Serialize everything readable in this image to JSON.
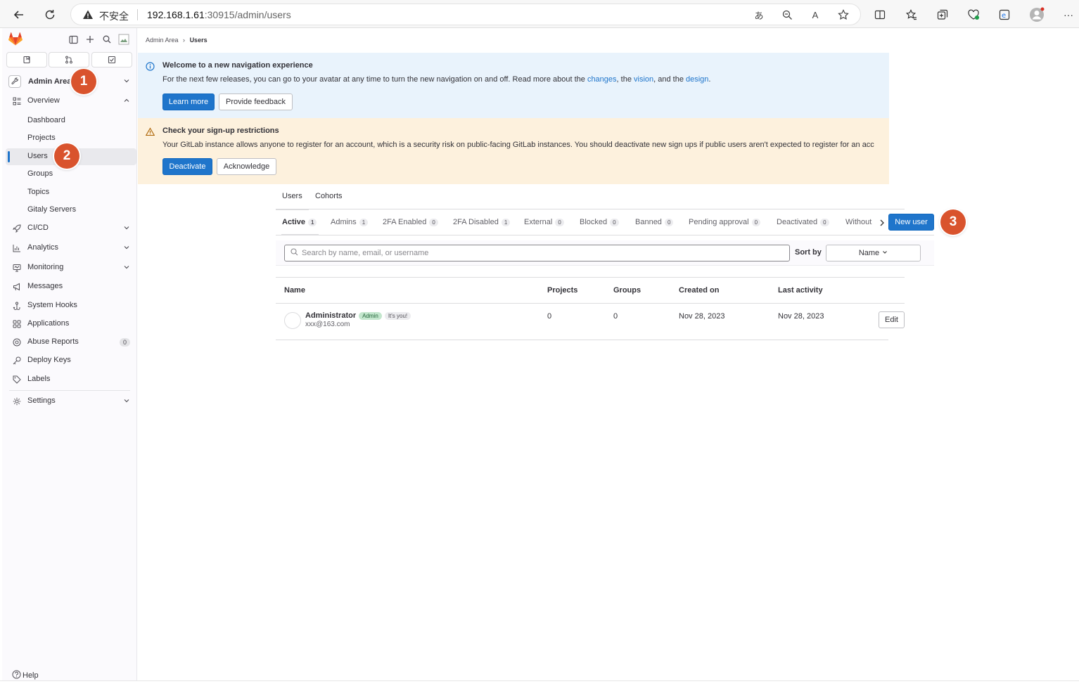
{
  "browser": {
    "security_label": "不安全",
    "url_host": "192.168.1.61",
    "url_path": ":30915/admin/users"
  },
  "sidebar": {
    "context_label": "Admin Area",
    "items": [
      {
        "label": "Overview",
        "icon": "overview-icon"
      },
      {
        "label": "Dashboard"
      },
      {
        "label": "Projects"
      },
      {
        "label": "Users"
      },
      {
        "label": "Groups"
      },
      {
        "label": "Topics"
      },
      {
        "label": "Gitaly Servers"
      },
      {
        "label": "CI/CD",
        "icon": "rocket-icon"
      },
      {
        "label": "Analytics",
        "icon": "chart-icon"
      },
      {
        "label": "Monitoring",
        "icon": "monitor-icon"
      },
      {
        "label": "Messages",
        "icon": "bullhorn-icon"
      },
      {
        "label": "System Hooks",
        "icon": "hook-icon"
      },
      {
        "label": "Applications",
        "icon": "applications-icon"
      },
      {
        "label": "Abuse Reports",
        "icon": "abuse-icon",
        "count": "0"
      },
      {
        "label": "Deploy Keys",
        "icon": "key-icon"
      },
      {
        "label": "Labels",
        "icon": "label-icon"
      },
      {
        "label": "Settings",
        "icon": "settings-icon"
      }
    ],
    "help_label": "Help"
  },
  "breadcrumb": {
    "parent": "Admin Area",
    "current": "Users"
  },
  "alerts": {
    "nav": {
      "title": "Welcome to a new navigation experience",
      "body_prefix": "For the next few releases, you can go to your avatar at any time to turn the new navigation on and off. Read more about the ",
      "link1": "changes",
      "sep1": ", the ",
      "link2": "vision",
      "sep2": ", and the ",
      "link3": "design",
      "end": ".",
      "primary_button": "Learn more",
      "secondary_button": "Provide feedback"
    },
    "signup": {
      "title": "Check your sign-up restrictions",
      "body": "Your GitLab instance allows anyone to register for an account, which is a security risk on public-facing GitLab instances. You should deactivate new sign ups if public users aren't expected to register for an acc",
      "primary_button": "Deactivate",
      "secondary_button": "Acknowledge"
    }
  },
  "top_tabs": [
    "Users",
    "Cohorts"
  ],
  "filter_tabs": [
    {
      "label": "Active",
      "count": "1"
    },
    {
      "label": "Admins",
      "count": "1"
    },
    {
      "label": "2FA Enabled",
      "count": "0"
    },
    {
      "label": "2FA Disabled",
      "count": "1"
    },
    {
      "label": "External",
      "count": "0"
    },
    {
      "label": "Blocked",
      "count": "0"
    },
    {
      "label": "Banned",
      "count": "0"
    },
    {
      "label": "Pending approval",
      "count": "0"
    },
    {
      "label": "Deactivated",
      "count": "0"
    },
    {
      "label": "Without",
      "count": ""
    }
  ],
  "new_user_button": "New user",
  "search": {
    "placeholder": "Search by name, email, or username",
    "sort_label": "Sort by",
    "sort_value": "Name"
  },
  "table": {
    "headers": [
      "Name",
      "Projects",
      "Groups",
      "Created on",
      "Last activity"
    ],
    "rows": [
      {
        "name": "Administrator",
        "badge_admin": "Admin",
        "badge_you": "It's you!",
        "email": "xxx@163.com",
        "projects": "0",
        "groups": "0",
        "created_on": "Nov 28, 2023",
        "last_activity": "Nov 28, 2023",
        "action": "Edit"
      }
    ]
  },
  "step_markers": [
    "1",
    "2",
    "3"
  ]
}
